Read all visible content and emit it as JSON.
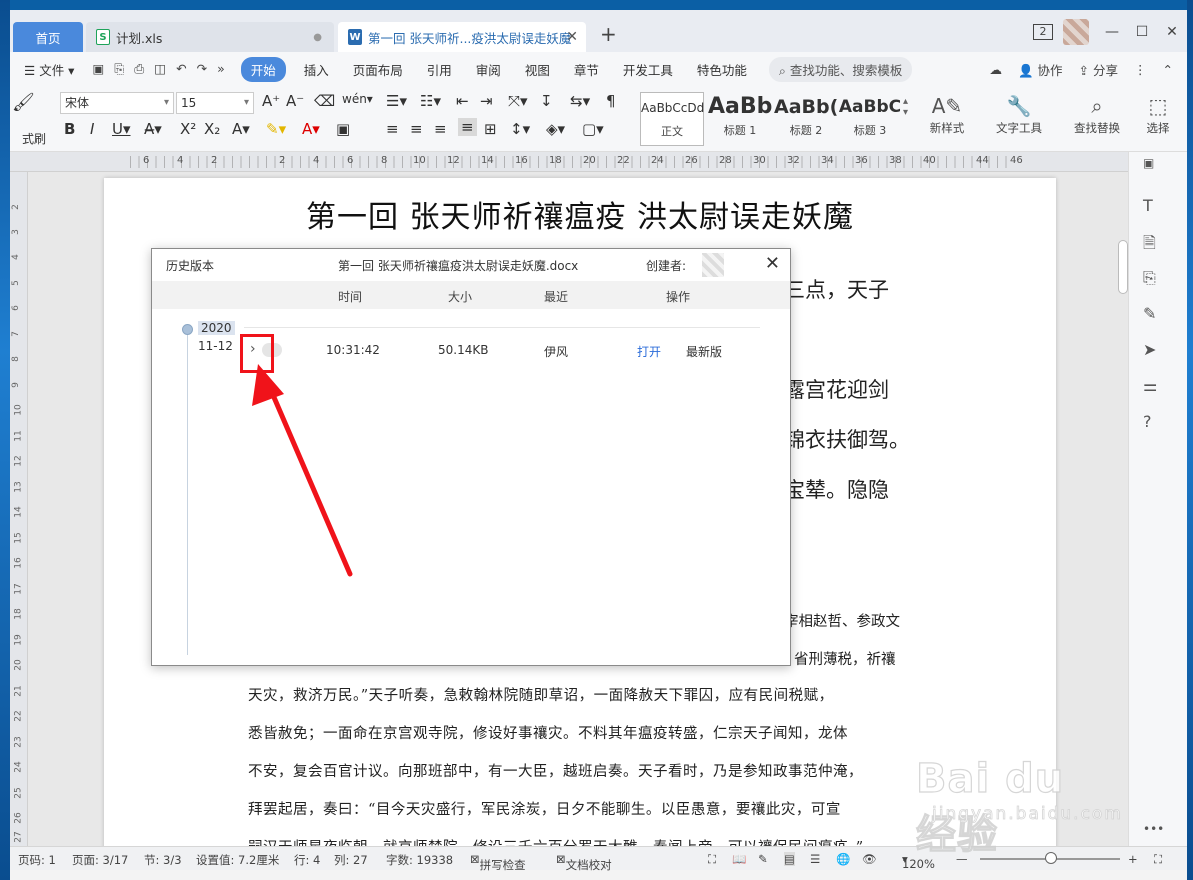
{
  "tabs": {
    "home": "首页",
    "xls": "计划.xls",
    "doc": "第一回 张天师祈...疫洪太尉误走妖魔",
    "badge": "2"
  },
  "menu": {
    "file": "文件",
    "items": [
      "开始",
      "插入",
      "页面布局",
      "引用",
      "审阅",
      "视图",
      "章节",
      "开发工具",
      "特色功能"
    ],
    "search": "查找功能、搜索模板",
    "collab": "协作",
    "share": "分享"
  },
  "ribbon": {
    "format_painter": "式刷",
    "font": "宋体",
    "size": "15",
    "styles": [
      {
        "sample": "AaBbCcDd",
        "label": "正文"
      },
      {
        "sample": "AaBb",
        "label": "标题 1"
      },
      {
        "sample": "AaBb(",
        "label": "标题 2"
      },
      {
        "sample": "AaBbC",
        "label": "标题 3"
      }
    ],
    "new_style": "新样式",
    "text_tools": "文字工具",
    "find_replace": "查找替换",
    "select": "选择"
  },
  "ruler": {
    "h_nums": [
      "6",
      "4",
      "2",
      "2",
      "4",
      "6",
      "8",
      "10",
      "12",
      "14",
      "16",
      "18",
      "20",
      "22",
      "24",
      "26",
      "28",
      "30",
      "32",
      "34",
      "36",
      "38",
      "40",
      "44",
      "46"
    ],
    "v_nums": [
      "2",
      "3",
      "4",
      "5",
      "6",
      "7",
      "8",
      "9",
      "10",
      "11",
      "12",
      "13",
      "14",
      "15",
      "16",
      "17",
      "18",
      "19",
      "20",
      "21",
      "22",
      "23",
      "24",
      "25",
      "26",
      "27"
    ]
  },
  "document": {
    "title": "第一回  张天师祈禳瘟疫    洪太尉误走妖魔",
    "frag1": "三点，天子",
    "frag2": "露宫花迎剑",
    "frag3": "锦衣扶御驾。",
    "frag4": "宝辇。隐隐",
    "frag5": "宰相赵哲、参政文",
    "frag6": "省刑薄税，祈禳",
    "lines": [
      "天灾，救济万民。”天子听奏，急敕翰林院随即草诏，一面降赦天下罪囚，应有民间税赋，",
      "悉皆赦免；一面命在京宫观寺院，修设好事禳灾。不料其年瘟疫转盛，仁宗天子闻知，龙体",
      "不安，复会百官计议。向那班部中，有一大臣，越班启奏。天子看时，乃是参知政事范仲淹，",
      "拜罢起居，奏曰：“目今天灾盛行，军民涂炭，日夕不能聊生。以臣愚意，要禳此灾，可宣",
      "嗣汉天师星夜临朝，就京师禁院，修设三千六百分罗天大醮，奏闻上帝，可以禳保民间瘟疫。”"
    ]
  },
  "dialog": {
    "title": "历史版本",
    "filename": "第一回 张天师祈禳瘟疫洪太尉误走妖魔.docx",
    "creator_label": "创建者:",
    "columns": [
      "时间",
      "大小",
      "最近",
      "操作"
    ],
    "year": "2020",
    "date": "11-12",
    "row": {
      "time": "10:31:42",
      "size": "50.14KB",
      "recent": "伊风",
      "open": "打开",
      "status": "最新版"
    }
  },
  "status": {
    "page_code": "页码: 1",
    "pages": "页面: 3/17",
    "section": "节: 3/3",
    "setting": "设置值: 7.2厘米",
    "row": "行: 4",
    "col": "列: 27",
    "words": "字数: 19338",
    "spell": "拼写检查",
    "proof": "文档校对",
    "zoom": "120%"
  },
  "watermark": {
    "main": "Bai du 经验",
    "sub": "jingyan.baidu.com"
  },
  "colors": {
    "accent": "#4a89dc",
    "highlight": "#f0131a",
    "link": "#2b6cd9"
  }
}
